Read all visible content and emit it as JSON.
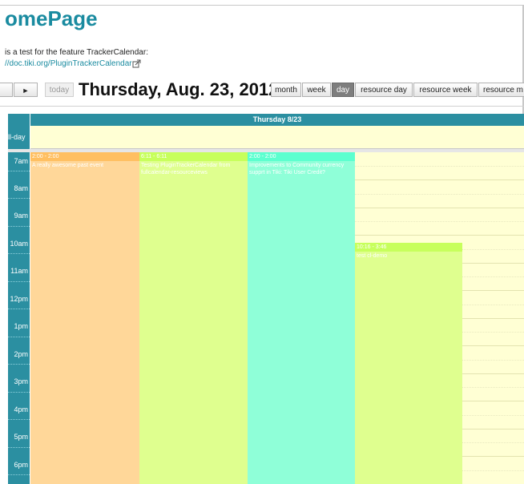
{
  "page": {
    "title": "omePage",
    "intro": "is a test for the feature TrackerCalendar:",
    "link": "//doc.tiki.org/PluginTrackerCalendar"
  },
  "toolbar": {
    "prev_label": "",
    "next_label": "►",
    "today_label": "today",
    "title": "Thursday, Aug. 23, 2012",
    "views": {
      "month": "month",
      "week": "week",
      "day": "day",
      "resource_day": "resource day",
      "resource_week": "resource week",
      "resource_month": "resource m"
    },
    "active_view": "day"
  },
  "calendar": {
    "day_header": "Thursday 8/23",
    "allday_label": "ll-day",
    "hours": [
      "7am",
      "8am",
      "9am",
      "10am",
      "11am",
      "12pm",
      "1pm",
      "2pm",
      "3pm",
      "4pm",
      "5pm",
      "6pm"
    ],
    "events": [
      {
        "time": "2:00 - 2:00",
        "title": "A really awesome past event",
        "color": "#ffd799"
      },
      {
        "time": "6:11 - 6:11",
        "title": "Testing PluginTrackerCalendar from fullcalendar-resourceviews",
        "color": "#dfff8f"
      },
      {
        "time": "2:00 - 2:00",
        "title": "Improvements to Community currency supprt in Tiki: Tiki User Credit?",
        "color": "#8fffd8"
      },
      {
        "time": "10:16 - 3:46",
        "title": "test cl-demo",
        "color": "#dfff8f"
      }
    ]
  },
  "colors": {
    "accent": "#1a8ba0",
    "header_bg": "#2b8fa1",
    "grid_bg": "#ffffd4"
  }
}
